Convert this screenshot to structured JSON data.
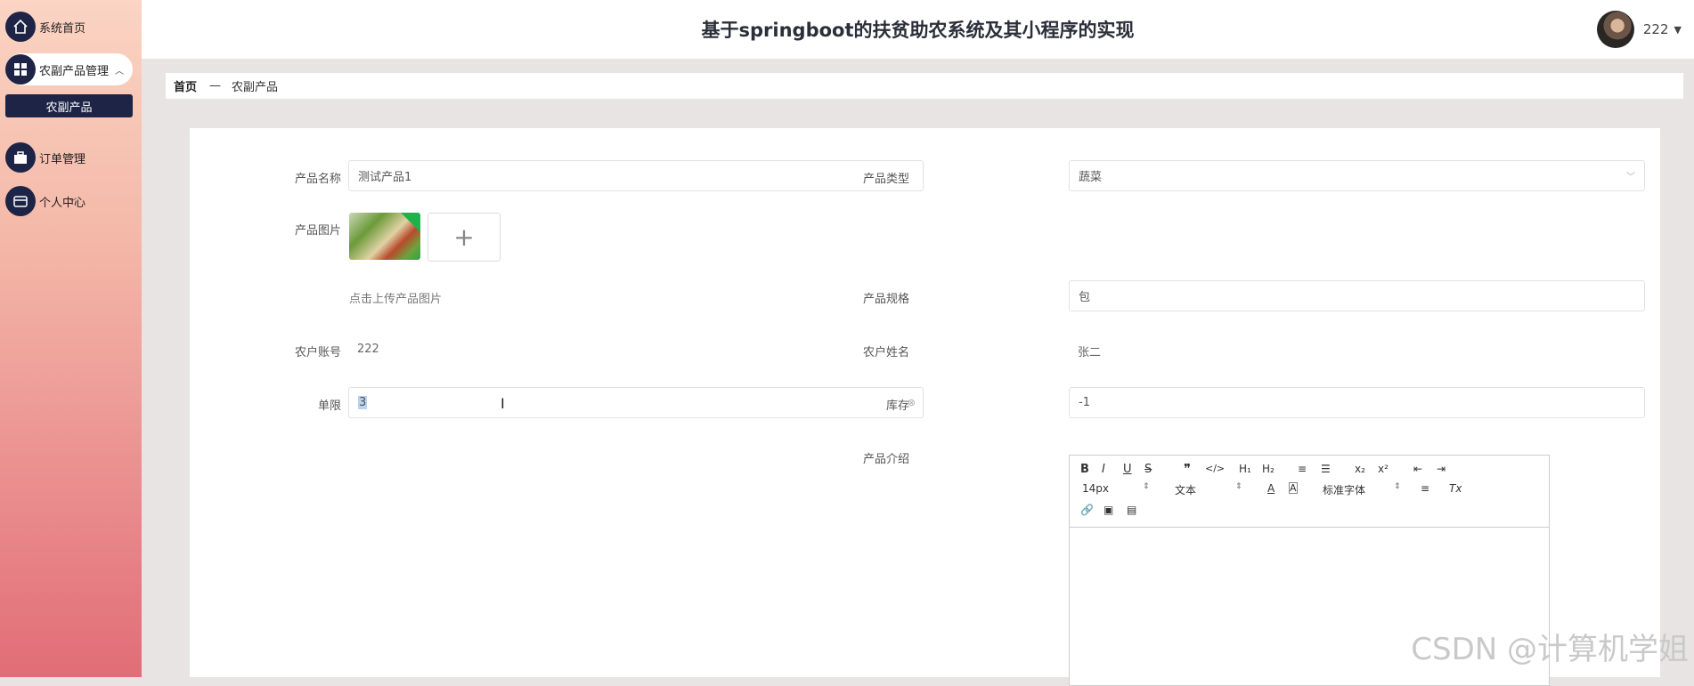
{
  "app_title": "基于springboot的扶贫助农系统及其小程序的实现",
  "user": {
    "name": "222"
  },
  "sidebar": {
    "items": [
      {
        "label": "系统首页",
        "icon": "home-icon"
      },
      {
        "label": "农副产品管理",
        "icon": "grid-icon",
        "expanded": true
      },
      {
        "label": "订单管理",
        "icon": "briefcase-icon"
      },
      {
        "label": "个人中心",
        "icon": "wallet-icon"
      }
    ],
    "sub_item": "农副产品"
  },
  "breadcrumb": {
    "home": "首页",
    "separator": "—",
    "current": "农副产品"
  },
  "form": {
    "name": {
      "label": "产品名称",
      "value": "测试产品1"
    },
    "type": {
      "label": "产品类型",
      "value": "蔬菜"
    },
    "image": {
      "label": "产品图片",
      "hint": "点击上传产品图片"
    },
    "spec": {
      "label": "产品规格",
      "value": "包"
    },
    "farmer_account": {
      "label": "农户账号",
      "value": "222"
    },
    "farmer_name": {
      "label": "农户姓名",
      "value": "张二"
    },
    "limit": {
      "label": "单限",
      "value": "3"
    },
    "stock": {
      "label": "库存",
      "value": "-1"
    },
    "intro": {
      "label": "产品介绍"
    }
  },
  "editor": {
    "font_size": "14px",
    "block_type": "文本",
    "font_family": "标准字体"
  },
  "watermark": "CSDN @计算机学姐",
  "colors": {
    "sidebar_dark": "#1d2446",
    "sidebar_top": "#fbd4c3",
    "sidebar_bottom": "#e16d77"
  }
}
